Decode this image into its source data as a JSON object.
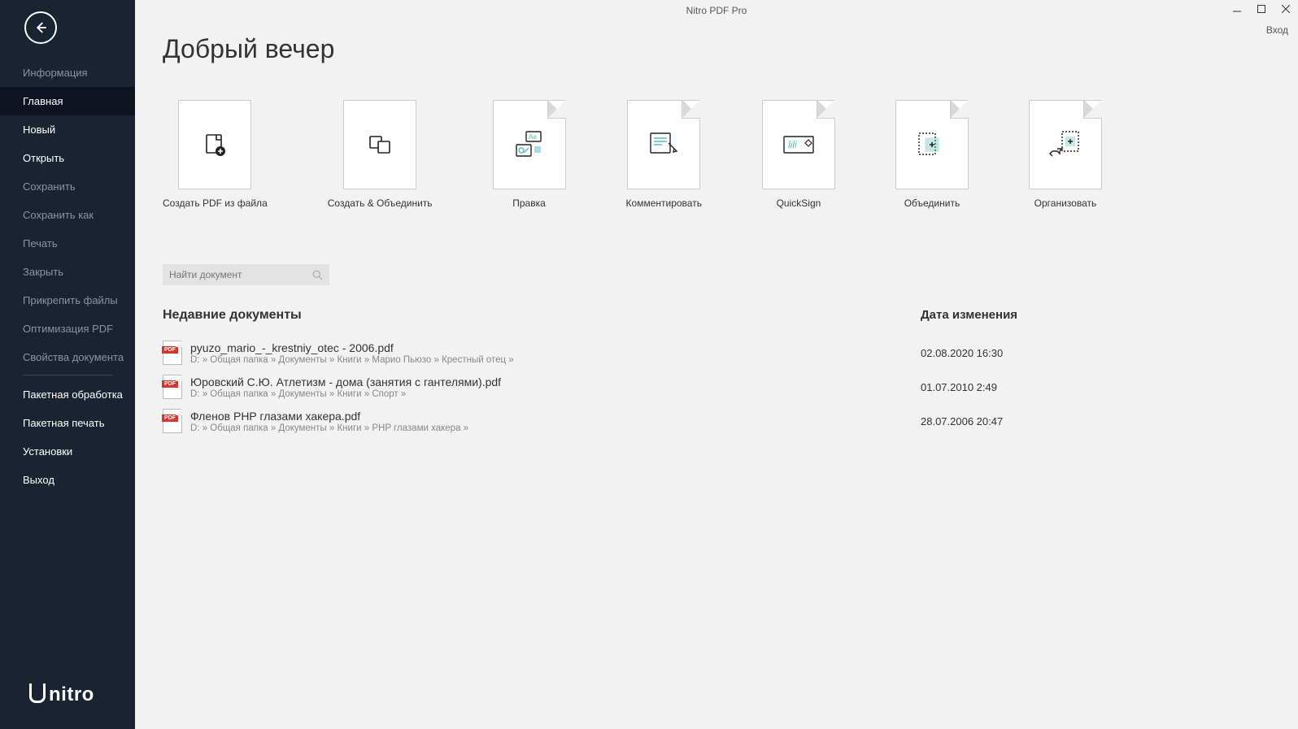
{
  "app_title": "Nitro PDF Pro",
  "login_label": "Вход",
  "greeting": "Добрый вечер",
  "sidebar": {
    "items": [
      {
        "label": "Информация",
        "enabled": false
      },
      {
        "label": "Главная",
        "enabled": true,
        "active": true
      },
      {
        "label": "Новый",
        "enabled": true
      },
      {
        "label": "Открыть",
        "enabled": true
      },
      {
        "label": "Сохранить",
        "enabled": false
      },
      {
        "label": "Сохранить как",
        "enabled": false
      },
      {
        "label": "Печать",
        "enabled": false
      },
      {
        "label": "Закрыть",
        "enabled": false
      },
      {
        "label": "Прикрепить файлы",
        "enabled": false
      },
      {
        "label": "Оптимизация PDF",
        "enabled": false
      },
      {
        "label": "Свойства документа",
        "enabled": false
      }
    ],
    "items2": [
      {
        "label": "Пакетная обработка"
      },
      {
        "label": "Пакетная печать"
      },
      {
        "label": "Установки"
      },
      {
        "label": "Выход"
      }
    ]
  },
  "actions": [
    {
      "label": "Создать PDF из файла",
      "icon": "page-plus"
    },
    {
      "label": "Создать & Объединить",
      "icon": "combine"
    },
    {
      "label": "Правка",
      "icon": "edit"
    },
    {
      "label": "Комментировать",
      "icon": "comment"
    },
    {
      "label": "QuickSign",
      "icon": "sign"
    },
    {
      "label": "Объединить",
      "icon": "merge"
    },
    {
      "label": "Организовать",
      "icon": "organize"
    }
  ],
  "search": {
    "placeholder": "Найти документ"
  },
  "recent": {
    "title": "Недавние документы",
    "date_title": "Дата изменения",
    "docs": [
      {
        "name": "pyuzo_mario_-_krestniy_otec - 2006.pdf",
        "path": "D: » Общая папка » Документы » Книги » Марио Пьюзо » Крестный отец »",
        "date": "02.08.2020 16:30"
      },
      {
        "name": "Юровский С.Ю. Атлетизм - дома (занятия с гантелями).pdf",
        "path": "D: » Общая папка » Документы » Книги » Спорт »",
        "date": "01.07.2010 2:49"
      },
      {
        "name": "Фленов PHP глазами хакера.pdf",
        "path": "D: » Общая папка » Документы » Книги » PHP глазами хакера »",
        "date": "28.07.2006 20:47"
      }
    ]
  },
  "logo": "nitro"
}
